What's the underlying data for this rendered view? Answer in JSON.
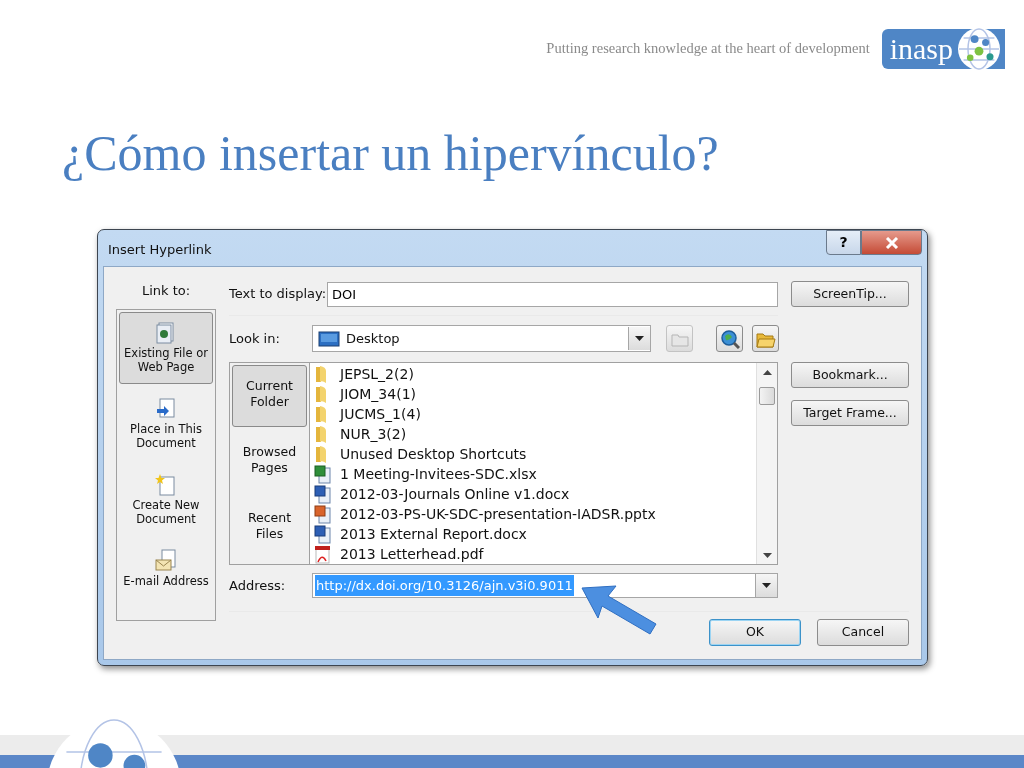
{
  "slide": {
    "tagline": "Putting research knowledge at the heart of development",
    "logo_text": "inasp",
    "title": "¿Cómo insertar un hipervínculo?"
  },
  "dialog": {
    "title": "Insert Hyperlink",
    "help_button": "?",
    "link_to": {
      "label": "Link to:",
      "items": [
        {
          "label": "Existing File or Web Page",
          "kind": "file",
          "selected": true
        },
        {
          "label": "Place in This Document",
          "kind": "place",
          "selected": false
        },
        {
          "label": "Create New Document",
          "kind": "new",
          "selected": false
        },
        {
          "label": "E-mail Address",
          "kind": "email",
          "selected": false
        }
      ]
    },
    "text_to_display": {
      "label": "Text to display:",
      "value": "DOI"
    },
    "look_in": {
      "label": "Look in:",
      "value": "Desktop"
    },
    "views": [
      {
        "label": "Current Folder",
        "selected": true
      },
      {
        "label": "Browsed Pages",
        "selected": false
      },
      {
        "label": "Recent Files",
        "selected": false
      }
    ],
    "files": [
      {
        "name": "JEPSL_2(2)",
        "kind": "folder"
      },
      {
        "name": "JIOM_34(1)",
        "kind": "folder"
      },
      {
        "name": "JUCMS_1(4)",
        "kind": "folder"
      },
      {
        "name": "NUR_3(2)",
        "kind": "folder"
      },
      {
        "name": "Unused Desktop Shortcuts",
        "kind": "folder"
      },
      {
        "name": "1 Meeting-Invitees-SDC.xlsx",
        "kind": "xlsx"
      },
      {
        "name": "2012-03-Journals Online v1.docx",
        "kind": "docx"
      },
      {
        "name": "2012-03-PS-UK-SDC-presentation-IADSR.pptx",
        "kind": "pptx"
      },
      {
        "name": "2013 External Report.docx",
        "kind": "docx"
      },
      {
        "name": "2013 Letterhead.pdf",
        "kind": "pdf"
      }
    ],
    "side_buttons": [
      "ScreenTip...",
      "Bookmark...",
      "Target Frame..."
    ],
    "address": {
      "label": "Address:",
      "value": "http://dx.doi.org/10.3126/ajn.v3i0.9011",
      "highlighted": true
    },
    "buttons": [
      {
        "label": "OK",
        "default": true
      },
      {
        "label": "Cancel",
        "default": false
      }
    ]
  }
}
